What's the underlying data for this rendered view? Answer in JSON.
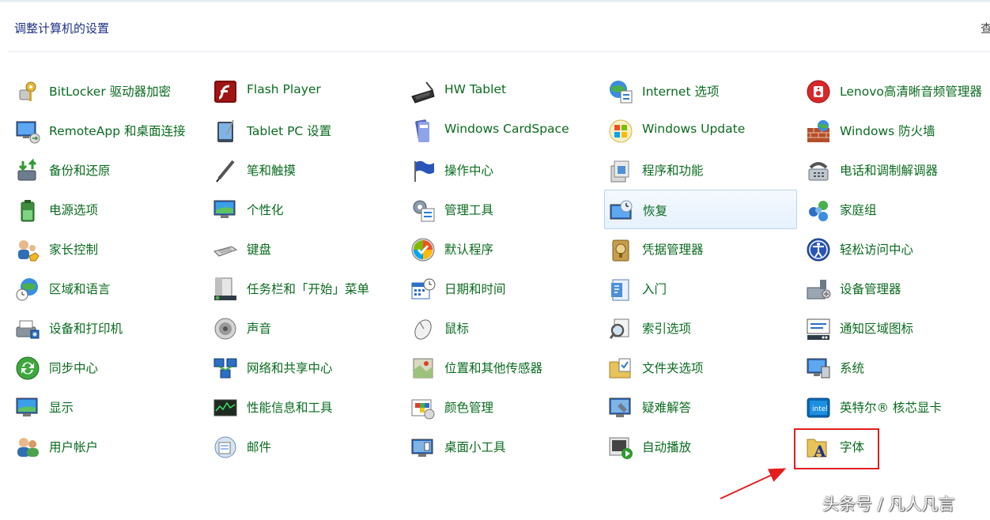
{
  "header": {
    "title": "调整计算机的设置",
    "view_by_partial": "查"
  },
  "items": [
    {
      "id": "bitlocker",
      "label": "BitLocker 驱动器加密",
      "icon": "key-lock-icon"
    },
    {
      "id": "flash",
      "label": "Flash Player",
      "icon": "flash-player-icon"
    },
    {
      "id": "hwtablet",
      "label": "HW Tablet",
      "icon": "pen-tablet-icon"
    },
    {
      "id": "internet",
      "label": "Internet 选项",
      "icon": "internet-options-icon"
    },
    {
      "id": "lenovo-audio",
      "label": "Lenovo高清晰音频管理器",
      "icon": "speaker-red-icon"
    },
    {
      "id": "remoteapp",
      "label": "RemoteApp 和桌面连接",
      "icon": "remote-desktop-icon"
    },
    {
      "id": "tabletpc",
      "label": "Tablet PC 设置",
      "icon": "tablet-pc-icon"
    },
    {
      "id": "cardspace",
      "label": "Windows CardSpace",
      "icon": "cardspace-icon"
    },
    {
      "id": "winupdate",
      "label": "Windows Update",
      "icon": "windows-update-icon"
    },
    {
      "id": "firewall",
      "label": "Windows 防火墙",
      "icon": "firewall-icon"
    },
    {
      "id": "backup",
      "label": "备份和还原",
      "icon": "backup-restore-icon"
    },
    {
      "id": "pen-touch",
      "label": "笔和触摸",
      "icon": "pen-icon"
    },
    {
      "id": "action-center",
      "label": "操作中心",
      "icon": "flag-icon"
    },
    {
      "id": "programs",
      "label": "程序和功能",
      "icon": "programs-features-icon"
    },
    {
      "id": "phone-modem",
      "label": "电话和调制解调器",
      "icon": "phone-modem-icon"
    },
    {
      "id": "power",
      "label": "电源选项",
      "icon": "battery-icon"
    },
    {
      "id": "personalize",
      "label": "个性化",
      "icon": "personalization-icon"
    },
    {
      "id": "admin-tools",
      "label": "管理工具",
      "icon": "admin-tools-icon"
    },
    {
      "id": "recovery",
      "label": "恢复",
      "icon": "recovery-icon",
      "hover": true
    },
    {
      "id": "homegroup",
      "label": "家庭组",
      "icon": "homegroup-icon"
    },
    {
      "id": "parental",
      "label": "家长控制",
      "icon": "parental-controls-icon"
    },
    {
      "id": "keyboard",
      "label": "键盘",
      "icon": "keyboard-icon"
    },
    {
      "id": "default-programs",
      "label": "默认程序",
      "icon": "default-programs-icon"
    },
    {
      "id": "credential",
      "label": "凭据管理器",
      "icon": "credential-manager-icon"
    },
    {
      "id": "ease-access",
      "label": "轻松访问中心",
      "icon": "ease-of-access-icon"
    },
    {
      "id": "region",
      "label": "区域和语言",
      "icon": "region-globe-icon"
    },
    {
      "id": "taskbar",
      "label": "任务栏和「开始」菜单",
      "icon": "taskbar-icon"
    },
    {
      "id": "datetime",
      "label": "日期和时间",
      "icon": "calendar-clock-icon"
    },
    {
      "id": "getting-started",
      "label": "入门",
      "icon": "getting-started-icon"
    },
    {
      "id": "device-manager",
      "label": "设备管理器",
      "icon": "device-manager-icon"
    },
    {
      "id": "devices-printers",
      "label": "设备和打印机",
      "icon": "printer-icon"
    },
    {
      "id": "sound",
      "label": "声音",
      "icon": "sound-icon"
    },
    {
      "id": "mouse",
      "label": "鼠标",
      "icon": "mouse-icon"
    },
    {
      "id": "indexing",
      "label": "索引选项",
      "icon": "indexing-icon"
    },
    {
      "id": "notification-icons",
      "label": "通知区域图标",
      "icon": "notification-area-icon"
    },
    {
      "id": "sync-center",
      "label": "同步中心",
      "icon": "sync-icon"
    },
    {
      "id": "network",
      "label": "网络和共享中心",
      "icon": "network-icon"
    },
    {
      "id": "location",
      "label": "位置和其他传感器",
      "icon": "location-sensor-icon"
    },
    {
      "id": "folder-options",
      "label": "文件夹选项",
      "icon": "folder-options-icon"
    },
    {
      "id": "system",
      "label": "系统",
      "icon": "system-icon"
    },
    {
      "id": "display",
      "label": "显示",
      "icon": "display-icon"
    },
    {
      "id": "performance",
      "label": "性能信息和工具",
      "icon": "performance-icon"
    },
    {
      "id": "color-mgmt",
      "label": "颜色管理",
      "icon": "color-management-icon"
    },
    {
      "id": "troubleshoot",
      "label": "疑难解答",
      "icon": "troubleshooting-icon"
    },
    {
      "id": "intel-graphics",
      "label": "英特尔® 核芯显卡",
      "icon": "intel-graphics-icon"
    },
    {
      "id": "user-accounts",
      "label": "用户帐户",
      "icon": "user-accounts-icon"
    },
    {
      "id": "mail",
      "label": "邮件",
      "icon": "mail-icon"
    },
    {
      "id": "gadgets",
      "label": "桌面小工具",
      "icon": "desktop-gadgets-icon"
    },
    {
      "id": "autoplay",
      "label": "自动播放",
      "icon": "autoplay-icon"
    },
    {
      "id": "fonts",
      "label": "字体",
      "icon": "fonts-folder-icon"
    }
  ],
  "annotation": {
    "highlight_color": "#e41c1c",
    "highlighted_item": "fonts"
  },
  "watermark": "头条号 / 凡人凡言",
  "colors": {
    "label_text": "#0a6b1f",
    "header_text": "#1e3287"
  }
}
